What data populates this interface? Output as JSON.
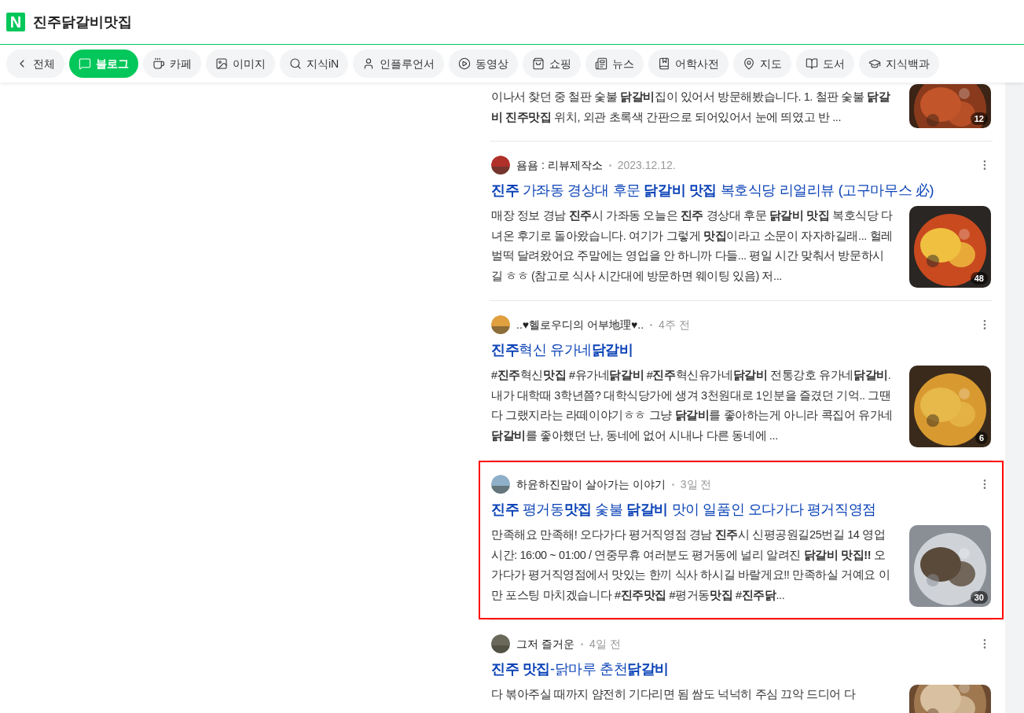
{
  "header": {
    "logo": "N",
    "query": "진주닭갈비맛집"
  },
  "tabs": [
    {
      "label": "전체",
      "selected": false
    },
    {
      "label": "블로그",
      "selected": true
    },
    {
      "label": "카페",
      "selected": false
    },
    {
      "label": "이미지",
      "selected": false
    },
    {
      "label": "지식iN",
      "selected": false
    },
    {
      "label": "인플루언서",
      "selected": false
    },
    {
      "label": "동영상",
      "selected": false
    },
    {
      "label": "쇼핑",
      "selected": false
    },
    {
      "label": "뉴스",
      "selected": false
    },
    {
      "label": "어학사전",
      "selected": false
    },
    {
      "label": "지도",
      "selected": false
    },
    {
      "label": "도서",
      "selected": false
    },
    {
      "label": "지식백과",
      "selected": false
    }
  ],
  "results": [
    {
      "kind": "partial",
      "highlighted": false,
      "snippet": "이나서 찾던 중 철판 숯불 **닭갈비**집이 있어서 방문해봤습니다. 1. 철판 숯불 **닭갈비 진주맛집** 위치, 외관 초록색 간판으로 되어있어서 눈에 띄였고 반 ...",
      "photo_count": "12"
    },
    {
      "kind": "full",
      "highlighted": false,
      "author": "욤욤 : 리뷰제작소",
      "date": "2023.12.12.",
      "title": "**진주** 가좌동 경상대 후문 **닭갈비 맛집** 복호식당 리얼리뷰 (고구마무스 必)",
      "snippet": "매장 정보 경남 **진주**시 가좌동 오늘은 **진주** 경상대 후문 **닭갈비 맛집** 복호식당 다녀온 후기로 돌아왔습니다. 여기가 그렇게 **맛집**이라고 소문이 자자하길래... 헐레벌떡 달려왔어요 주말에는 영업을 안 하니까 다들... 평일 시간 맞춰서 방문하시길 ㅎㅎ (참고로 식사 시간대에 방문하면 웨이팅 있음) 저...",
      "photo_count": "48"
    },
    {
      "kind": "full",
      "highlighted": false,
      "author": "..♥헬로우디의 어부地理♥..",
      "date": "4주 전",
      "title": "**진주**혁신 유가네**닭갈비**",
      "snippet": "#**진주**혁신**맛집** #유가네**닭갈비** #**진주**혁신유가네**닭갈비** 전통강호 유가네**닭갈비**. 내가 대학때 3학년쯤? 대학식당가에 생겨 3천원대로 1인분을 즐겼던 기억.. 그땐 다 그랬지라는 라떼이야기ㅎㅎ 그냥 **닭갈비**를 좋아하는게 아니라 콕집어 유가네**닭갈비**를 좋아했던 난, 동네에 없어 시내나 다른 동네에 ...",
      "photo_count": "6"
    },
    {
      "kind": "full",
      "highlighted": true,
      "author": "하윤하진맘이 살아가는 이야기",
      "date": "3일 전",
      "title": "**진주** 평거동**맛집** 숯불 **닭갈비** 맛이 일품인 오다가다 평거직영점",
      "snippet": "만족해요 만족해! 오다가다 평거직영점 경남 **진주**시 신평공원길25번길 14 영업시간: 16:00 ~ 01:00 / 연중무휴 여러분도 평거동에 널리 알려진 **닭갈비 맛집!!** 오가다가 평거직영점에서 맛있는 한끼 식사 하시길 바랄게요!! 만족하실 거예요 이만 포스팅 마치겠습니다 #**진주맛집** #평거동**맛집** #**진주닭**...",
      "photo_count": "30"
    },
    {
      "kind": "cut",
      "highlighted": false,
      "author": "그저 즐거운",
      "date": "4일 전",
      "title": "**진주 맛집**-닭마루 춘천**닭갈비**",
      "snippet": "다 볶아주실 때까지 얌전히 기다리면 됨 쌈도 넉넉히 주심 끄악 드디어 다"
    }
  ]
}
